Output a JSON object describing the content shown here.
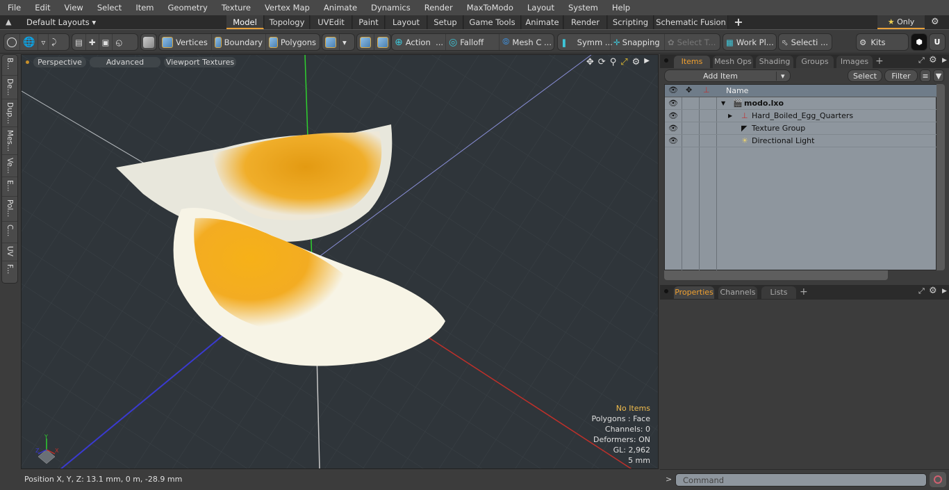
{
  "menu": [
    "File",
    "Edit",
    "View",
    "Select",
    "Item",
    "Geometry",
    "Texture",
    "Vertex Map",
    "Animate",
    "Dynamics",
    "Render",
    "MaxToModo",
    "Layout",
    "System",
    "Help"
  ],
  "layoutbar": {
    "layouts_label": "Default Layouts",
    "tabs": [
      "Model",
      "Topology",
      "UVEdit",
      "Paint",
      "Layout",
      "Setup",
      "Game Tools",
      "Animate",
      "Render",
      "Scripting",
      "Schematic Fusion"
    ],
    "active_tab": "Model",
    "add_tab": "+",
    "only_label": "Only"
  },
  "toolbar": {
    "vertices": "Vertices",
    "boundary": "Boundary",
    "polygons": "Polygons",
    "action": "Action",
    "falloff": "Falloff",
    "mesh_c": "Mesh C ...",
    "symm": "Symm ...",
    "snapping": "Snapping",
    "select_t": "Select T...",
    "work_pl": "Work Pl...",
    "selecti": "Selecti ...",
    "kits": "Kits",
    "ellipsis": "..."
  },
  "left_tabs": [
    "B...",
    "De...",
    "Dup...",
    "Mes...",
    "Ve...",
    "E...",
    "Pol...",
    "C...",
    "UV",
    "F..."
  ],
  "viewport": {
    "view_mode": "Perspective",
    "shading": "Advanced",
    "textures": "Viewport Textures",
    "stats": {
      "selection": "No Items",
      "polygons": "Polygons : Face",
      "channels": "Channels: 0",
      "deformers": "Deformers: ON",
      "gl": "GL: 2,962",
      "grid": "5 mm"
    },
    "axis_labels": {
      "x": "X",
      "y": "Y",
      "z": "Z"
    },
    "colors": {
      "x_axis": "#c0302a",
      "y_axis": "#2fd02f",
      "z_axis": "#3a3ad0",
      "background": "#2f353a"
    }
  },
  "status": {
    "position": "Position X, Y, Z:   13.1 mm, 0 m, -28.9 mm"
  },
  "items_panel": {
    "tabs": [
      "Items",
      "Mesh Ops",
      "Shading",
      "Groups",
      "Images"
    ],
    "active_tab": "Items",
    "add_item": "Add Item",
    "select": "Select",
    "filter": "Filter",
    "column_name": "Name",
    "tree": [
      {
        "label": "modo.lxo",
        "bold": true,
        "icon": "scene-icon"
      },
      {
        "label": "Hard_Boiled_Egg_Quarters",
        "icon": "mesh-locator-icon"
      },
      {
        "label": "Texture Group",
        "icon": "texture-group-icon"
      },
      {
        "label": "Directional Light",
        "icon": "directional-light-icon"
      }
    ]
  },
  "properties_panel": {
    "tabs": [
      "Properties",
      "Channels",
      "Lists"
    ],
    "active_tab": "Properties"
  },
  "command": {
    "placeholder": "Command",
    "prompt": ">"
  },
  "accent": "#e8a13a"
}
